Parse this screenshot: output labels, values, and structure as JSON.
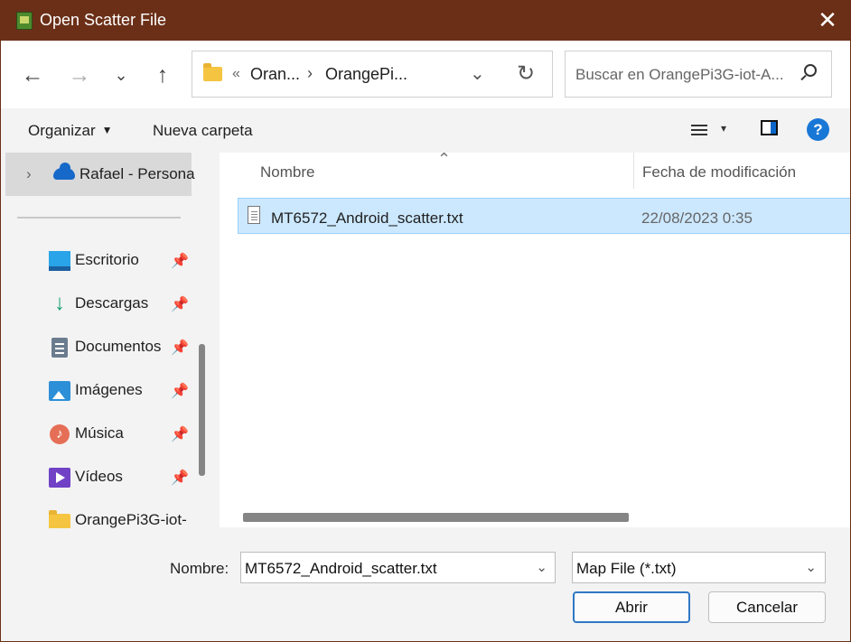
{
  "window": {
    "title": "Open Scatter File",
    "close_symbol": "✕"
  },
  "navigation": {
    "back_symbol": "←",
    "forward_symbol": "→",
    "recent_symbol": "⌄",
    "up_symbol": "↑",
    "address": {
      "overflow": "«",
      "segment_1": "Oran...",
      "separator": "›",
      "segment_2": "OrangePi...",
      "dropdown_symbol": "⌄",
      "refresh_symbol": "↻"
    },
    "search": {
      "placeholder": "Buscar en OrangePi3G-iot-A..."
    }
  },
  "toolbar": {
    "organize": "Organizar",
    "new_folder": "Nueva carpeta",
    "view_dropdown_symbol": "▾",
    "help_symbol": "?"
  },
  "sidebar": {
    "selected": {
      "expander": "›",
      "label": "Rafael - Persona"
    },
    "pin_symbol": "📌",
    "items": [
      {
        "label": "Escritorio",
        "icon": "desktop-icon",
        "pinned": true
      },
      {
        "label": "Descargas",
        "icon": "download-icon",
        "pinned": true
      },
      {
        "label": "Documentos",
        "icon": "documents-icon",
        "pinned": true
      },
      {
        "label": "Imágenes",
        "icon": "images-icon",
        "pinned": true
      },
      {
        "label": "Música",
        "icon": "music-icon",
        "pinned": true
      },
      {
        "label": "Vídeos",
        "icon": "videos-icon",
        "pinned": true
      },
      {
        "label": "OrangePi3G-iot-",
        "icon": "folder-icon",
        "pinned": false
      }
    ]
  },
  "file_list": {
    "sort_symbol": "⌃",
    "columns": [
      "Nombre",
      "Fecha de modificación"
    ],
    "rows": [
      {
        "name": "MT6572_Android_scatter.txt",
        "modified": "22/08/2023 0:35",
        "selected": true
      }
    ]
  },
  "footer": {
    "filename_label": "Nombre:",
    "filename_value": "MT6572_Android_scatter.txt",
    "filename_dropdown_symbol": "⌄",
    "filetype_value": "Map File (*.txt)",
    "filetype_dropdown_symbol": "⌄",
    "open_button": "Abrir",
    "cancel_button": "Cancelar"
  },
  "colors": {
    "titlebar": "#6b2f17",
    "selection": "#cce8ff",
    "accent": "#2f78c4"
  }
}
